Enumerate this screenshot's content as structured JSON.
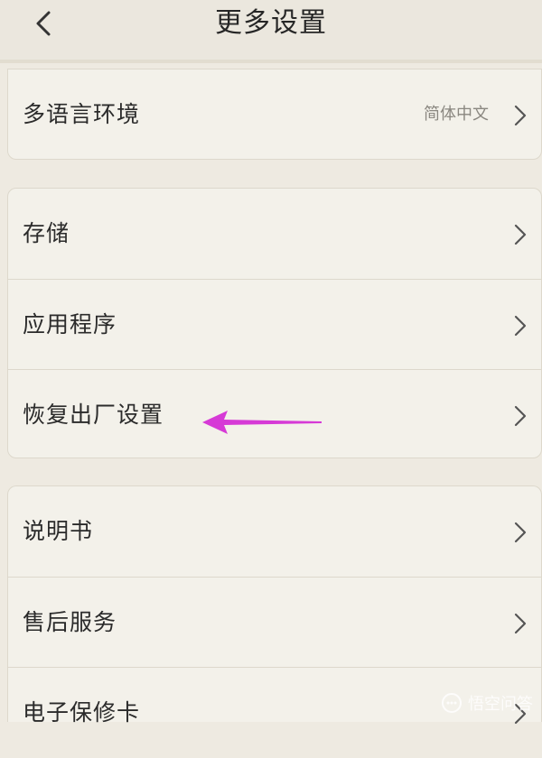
{
  "header": {
    "title": "更多设置"
  },
  "groups": [
    {
      "items": [
        {
          "label": "多语言环境",
          "value": "简体中文"
        }
      ]
    },
    {
      "items": [
        {
          "label": "存储"
        },
        {
          "label": "应用程序"
        },
        {
          "label": "恢复出厂设置"
        }
      ]
    },
    {
      "items": [
        {
          "label": "说明书"
        },
        {
          "label": "售后服务"
        },
        {
          "label": "电子保修卡"
        }
      ]
    }
  ],
  "annotation": {
    "color": "#d63ad6"
  },
  "watermark": {
    "text": "悟空问答"
  },
  "icons": {
    "back": "chevron-left-icon",
    "row": "chevron-right-icon",
    "annotation": "pointer-arrow-icon"
  }
}
